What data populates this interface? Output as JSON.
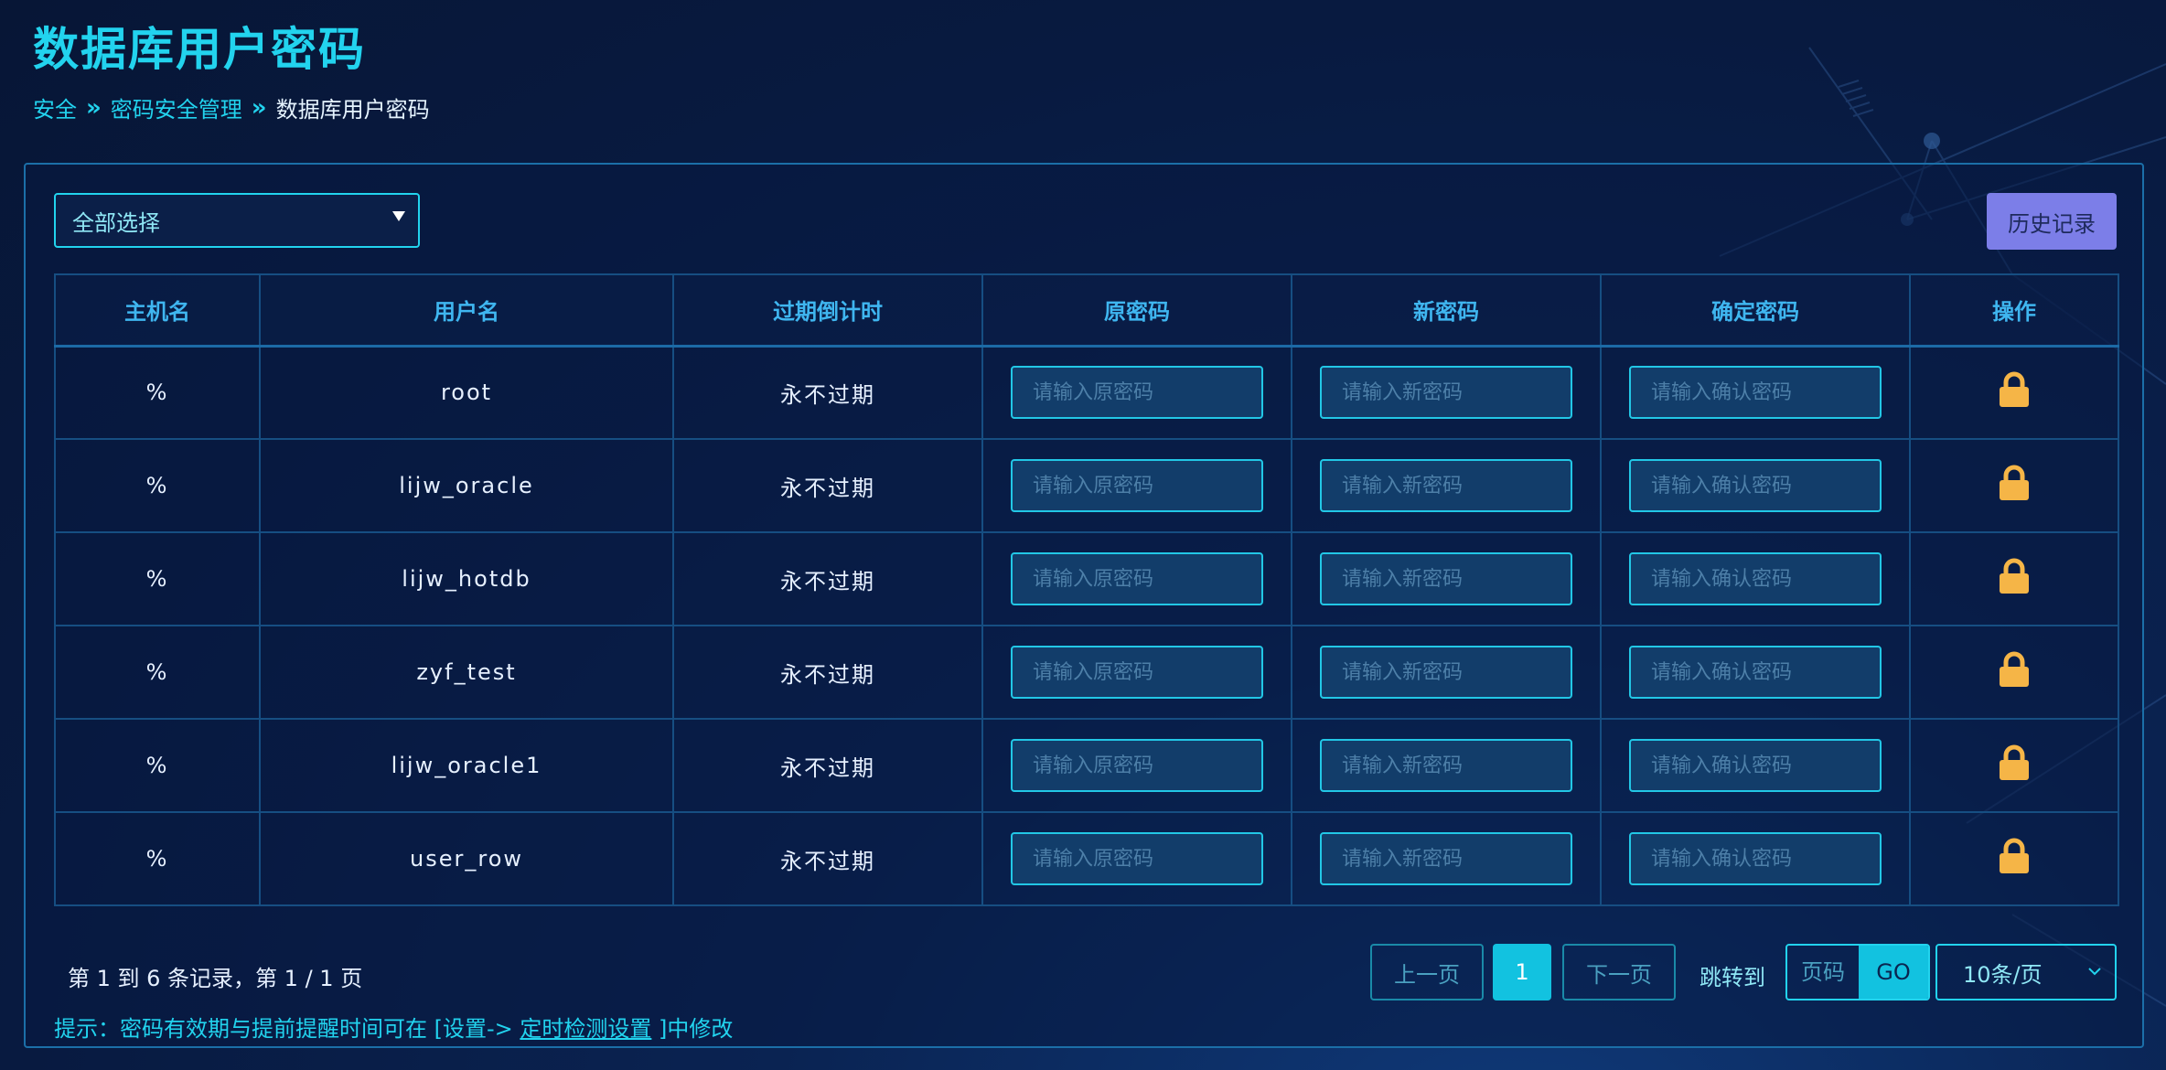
{
  "page": {
    "title": "数据库用户密码"
  },
  "breadcrumb": {
    "items": [
      "安全",
      "密码安全管理",
      "数据库用户密码"
    ]
  },
  "toolbar": {
    "select_value": "全部选择",
    "history_label": "历史记录"
  },
  "table": {
    "headers": [
      "主机名",
      "用户名",
      "过期倒计时",
      "原密码",
      "新密码",
      "确定密码",
      "操作"
    ],
    "placeholders": {
      "old": "请输入原密码",
      "new": "请输入新密码",
      "confirm": "请输入确认密码"
    },
    "rows": [
      {
        "host": "%",
        "user": "root",
        "expiry": "永不过期"
      },
      {
        "host": "%",
        "user": "lijw_oracle",
        "expiry": "永不过期"
      },
      {
        "host": "%",
        "user": "lijw_hotdb",
        "expiry": "永不过期"
      },
      {
        "host": "%",
        "user": "zyf_test",
        "expiry": "永不过期"
      },
      {
        "host": "%",
        "user": "lijw_oracle1",
        "expiry": "永不过期"
      },
      {
        "host": "%",
        "user": "user_row",
        "expiry": "永不过期"
      }
    ],
    "action_icon": "lock-icon"
  },
  "footer": {
    "record_info": "第 1 到 6 条记录，第 1 / 1 页",
    "hint_prefix": "提示：密码有效期与提前提醒时间可在 [设置-> ",
    "hint_link": "定时检测设置",
    "hint_suffix": " ]中修改"
  },
  "pagination": {
    "prev_label": "上一页",
    "current_page": "1",
    "next_label": "下一页",
    "jump_label": "跳转到",
    "page_placeholder": "页码",
    "go_label": "GO",
    "page_size": "10条/页"
  },
  "colors": {
    "accent": "#22d3ee",
    "lock": "#f5b547",
    "history_button": "#7c7ee8",
    "active_page": "#12c2e0"
  }
}
